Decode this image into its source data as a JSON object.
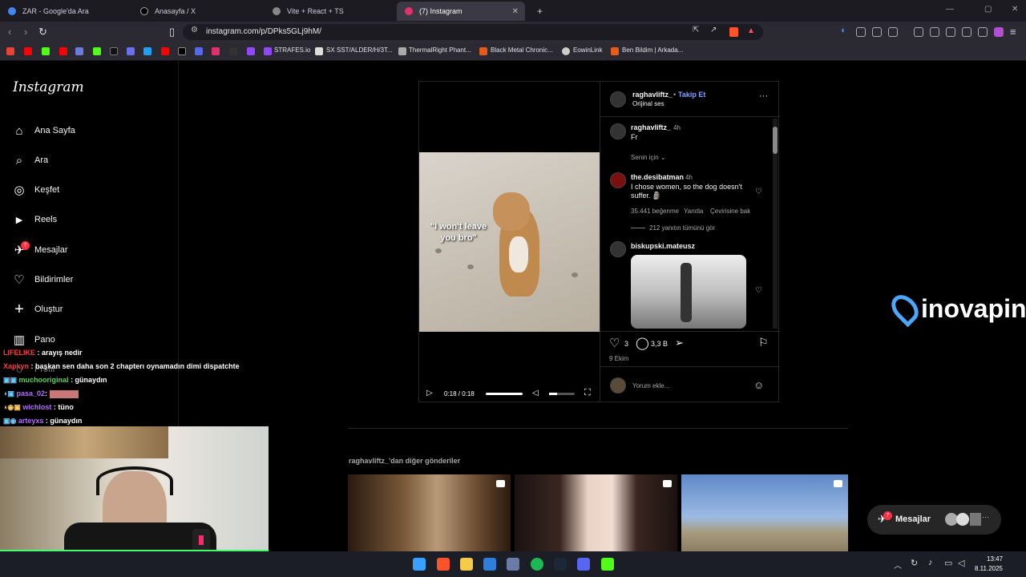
{
  "tabs": [
    {
      "title": "ZAR - Google'da Ara",
      "fav": "#4285f4"
    },
    {
      "title": "Anasayfa / X",
      "fav": "#000000"
    },
    {
      "title": "Vite + React + TS",
      "fav": "#888888"
    },
    {
      "title": "(7) Instagram",
      "fav": "#e1306c"
    }
  ],
  "url": "instagram.com/p/DPks5GLj9hM/",
  "bookmarks": [
    "STRAFES.io",
    "SX SST/ALDER/H/3T...",
    "ThermalRight Phant...",
    "Black Metal Chronic...",
    "EowinLink",
    "Ben Bildim | Arkada..."
  ],
  "sidebar": {
    "logo": "Instagram",
    "items": [
      {
        "label": "Ana Sayfa",
        "icon": "home-icon",
        "glyph": "⌂"
      },
      {
        "label": "Ara",
        "icon": "search-icon",
        "glyph": "⌕"
      },
      {
        "label": "Keşfet",
        "icon": "compass-icon",
        "glyph": "◎"
      },
      {
        "label": "Reels",
        "icon": "reels-icon",
        "glyph": "▶"
      },
      {
        "label": "Mesajlar",
        "icon": "messenger-icon",
        "glyph": "✈"
      },
      {
        "label": "Bildirimler",
        "icon": "heart-icon",
        "glyph": "♡"
      },
      {
        "label": "Oluştur",
        "icon": "plus-icon",
        "glyph": "+"
      },
      {
        "label": "Pano",
        "icon": "dashboard-icon",
        "glyph": "▥"
      },
      {
        "label": "Profil",
        "icon": "profile-icon",
        "glyph": "○"
      }
    ],
    "messages_badge": "7"
  },
  "chat": [
    {
      "user": "LIFELIKE",
      "color": "#ff3b3b",
      "text": ": arayış nedir"
    },
    {
      "user": "Xapkyn",
      "color": "#ff3b3b",
      "text": ": başkan sen daha son 2 chapterı oynamadın dimi dispatchte"
    },
    {
      "user": "muchooriginal",
      "color": "#5ad35a",
      "text": ": günaydın"
    },
    {
      "user": "pasa_02",
      "color": "#b56cff",
      "text": ":"
    },
    {
      "user": "wichlost",
      "color": "#b56cff",
      "text": ": tüno"
    },
    {
      "user": "arteyxs",
      "color": "#b56cff",
      "text": ": günaydın"
    }
  ],
  "post": {
    "author": "raghavliftz_",
    "follow": "Takip Et",
    "audio": "Orijinal ses",
    "caption_overlay": "\"I won't leave you bro\"",
    "video_time": "0:18 / 0:18",
    "op_comment": {
      "user": "raghavliftz_",
      "time": "4h",
      "text": "Fr"
    },
    "for_you": "Senin için",
    "comments": [
      {
        "user": "the.desibatman",
        "time": "4h",
        "text": "I chose women, so the dog doesn't suffer. 🗿",
        "likes": "35.441 beğenme",
        "reply": "Yanıtla",
        "translate": "Çevirisine bak",
        "view_replies": "212 yanıtın tümünü gör"
      },
      {
        "user": "biskupski.mateusz"
      }
    ],
    "likes": "3",
    "comments_count": "3,3 B",
    "date": "9 Ekim",
    "add_comment_placeholder": "Yorum ekle..."
  },
  "more_posts_label": "raghavliftz_'dan diğer gönderiler",
  "watermark": "inovapin",
  "messages_pill": {
    "label": "Mesajlar",
    "badge": "7"
  },
  "clock": {
    "time": "13:47",
    "date": "8.11.2025"
  }
}
